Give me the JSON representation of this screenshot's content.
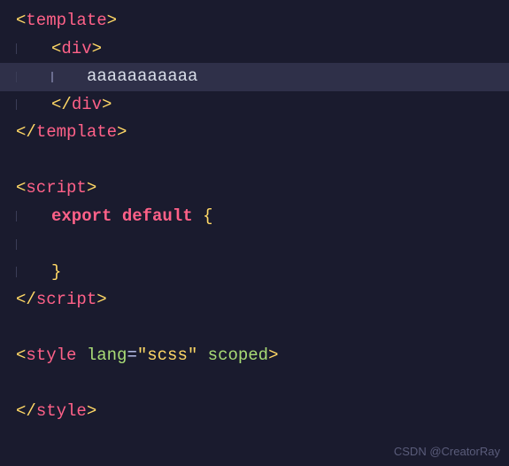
{
  "code": {
    "line1": {
      "open": "<",
      "tag": "template",
      "close": ">"
    },
    "line2": {
      "open": "<",
      "tag": "div",
      "close": ">"
    },
    "line3": {
      "text": "aaaaaaaaaaa"
    },
    "line4": {
      "open": "</",
      "tag": "div",
      "close": ">"
    },
    "line5": {
      "open": "</",
      "tag": "template",
      "close": ">"
    },
    "line7": {
      "open": "<",
      "tag": "script",
      "close": ">"
    },
    "line8": {
      "kw1": "export",
      "kw2": "default",
      "brace": "{"
    },
    "line10": {
      "brace": "}"
    },
    "line11": {
      "open": "</",
      "tag": "script",
      "close": ">"
    },
    "line13": {
      "open": "<",
      "tag": "style",
      "attr": "lang",
      "eq": "=",
      "val": "\"scss\"",
      "attr2": "scoped",
      "close": ">"
    },
    "line15": {
      "open": "</",
      "tag": "style",
      "close": ">"
    }
  },
  "watermark": "CSDN @CreatorRay"
}
